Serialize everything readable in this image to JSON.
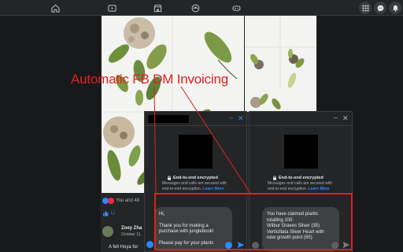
{
  "annotation": {
    "label": "Automatic FB DM Invoicing"
  },
  "post": {
    "reactions_text": "You and 48",
    "like_label": "Li",
    "comment": {
      "name": "Zoey Zha",
      "date": "October 11,",
      "text": "A fell Hoya for"
    }
  },
  "chat_left": {
    "e2e_title": "End-to-end encrypted",
    "e2e_text": "Messages and calls are secured with end-to-end encryption.",
    "learn_more": "Learn More",
    "message_lines": [
      "Hi,",
      "",
      "Thank you for making a",
      "purchase with junglebook!",
      "",
      "Please pay for your plants"
    ]
  },
  "chat_right": {
    "e2e_title": "End-to-end encrypted",
    "e2e_text": "Messages and calls are secured with end-to-end encryption.",
    "learn_more": "Learn More",
    "message_lines": [
      "You have claimed plants",
      "totalling 100:",
      "Wilbur Graves Silver (35)",
      "Verticillata Silver Heart with",
      "new growth point (65)"
    ]
  },
  "colors": {
    "accent": "#2d88ff",
    "annotation": "#e02020",
    "background": "#18191a",
    "panel": "#242526"
  }
}
